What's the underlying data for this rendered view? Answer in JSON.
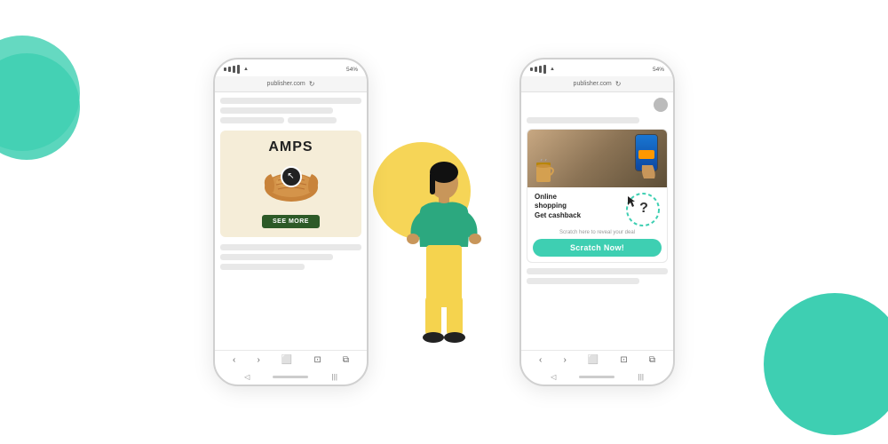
{
  "background": {
    "teal_color": "#3ecfb2",
    "yellow_color": "#f5d34e"
  },
  "phone1": {
    "url": "publisher.com",
    "status_bar": {
      "signal": "|||",
      "wifi": "▲",
      "battery": "54%"
    },
    "ad": {
      "title": "AMPS",
      "button": "SEE MORE",
      "bg_color": "#f5edd8"
    },
    "nav_items": [
      "‹",
      "›",
      "⬜",
      "⊡",
      "⧉"
    ]
  },
  "phone2": {
    "url": "publisher.com",
    "status_bar": {
      "signal": "|||",
      "wifi": "▲",
      "battery": "54%"
    },
    "ad": {
      "headline_line1": "Online",
      "headline_line2": "shopping",
      "headline_line3": "Get cashback",
      "subtext": "Scratch here to reveal your deal",
      "button": "Scratch Now!",
      "button_color": "#3ecfb2"
    },
    "nav_items": [
      "‹",
      "›",
      "⬜",
      "⊡",
      "⧉"
    ]
  },
  "person": {
    "body_color": "#222222",
    "hair_color": "#111111",
    "shirt_color": "#2ca87f",
    "pants_color": "#f5d34e",
    "skin_color": "#c8965a"
  }
}
